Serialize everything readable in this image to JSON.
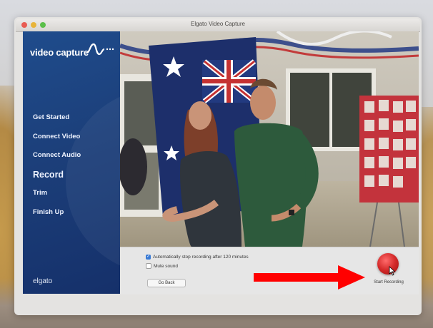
{
  "window": {
    "title": "Elgato Video Capture"
  },
  "sidebar": {
    "logo_text": "video capture",
    "items": [
      {
        "label": "Get Started",
        "active": false
      },
      {
        "label": "Connect Video",
        "active": false
      },
      {
        "label": "Connect Audio",
        "active": false
      },
      {
        "label": "Record",
        "active": true
      },
      {
        "label": "Trim",
        "active": false
      },
      {
        "label": "Finish Up",
        "active": false
      }
    ],
    "brand": "elgato"
  },
  "controls": {
    "auto_stop": {
      "label": "Automatically stop recording after 120 minutes",
      "checked": true
    },
    "mute": {
      "label": "Mute sound",
      "checked": false
    },
    "go_back_label": "Go Back",
    "start_recording_label": "Start Recording"
  },
  "colors": {
    "sidebar": "#1c3f7a",
    "record_button": "#d42a2a",
    "annotation_arrow": "#ff0000",
    "checkbox_accent": "#3a7bd5"
  },
  "icons": {
    "logo_wave": "waveform-icon",
    "record_button": "record-icon",
    "cursor": "mouse-cursor-icon",
    "arrow": "red-arrow-annotation"
  }
}
